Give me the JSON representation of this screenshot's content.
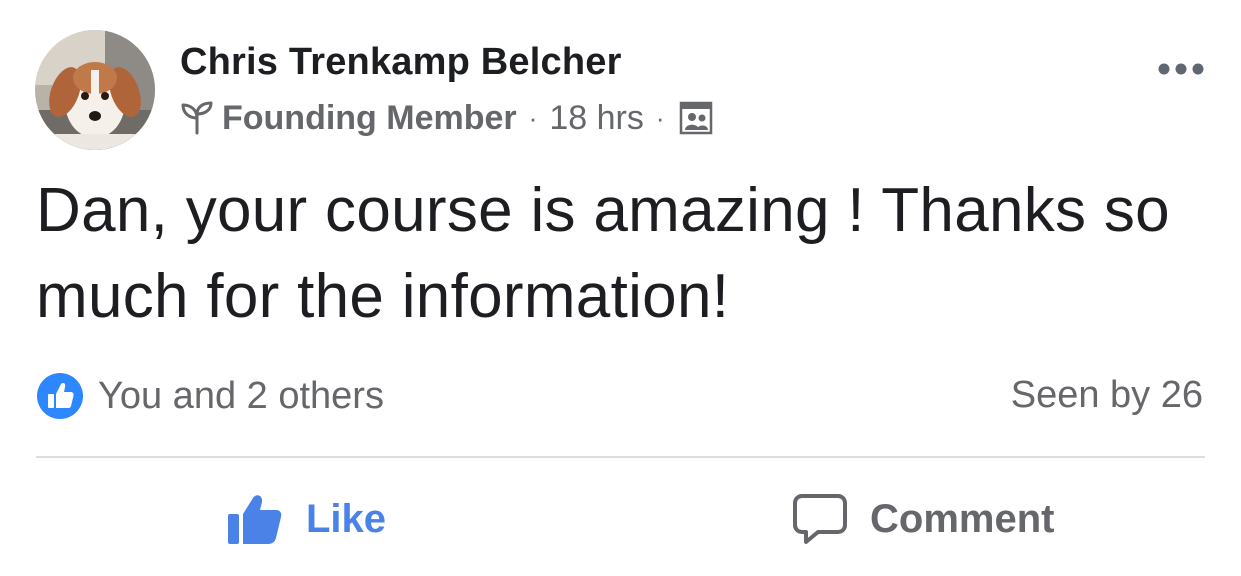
{
  "post": {
    "author": "Chris Trenkamp Belcher",
    "badge": "Founding Member",
    "separator": "·",
    "time": "18 hrs",
    "body": "Dan, your course is amazing ! Thanks so much for the information!",
    "audience_icon": "group-audience-icon",
    "more_icon": "more-options-icon"
  },
  "reactions": {
    "summary": "You and 2 others",
    "seen": "Seen by 26",
    "reaction_icon": "like-reaction-icon"
  },
  "actions": {
    "like_label": "Like",
    "comment_label": "Comment"
  },
  "colors": {
    "accent": "#4a82e8",
    "text": "#1c1e21",
    "secondary": "#65676b",
    "divider": "#dadde1"
  }
}
